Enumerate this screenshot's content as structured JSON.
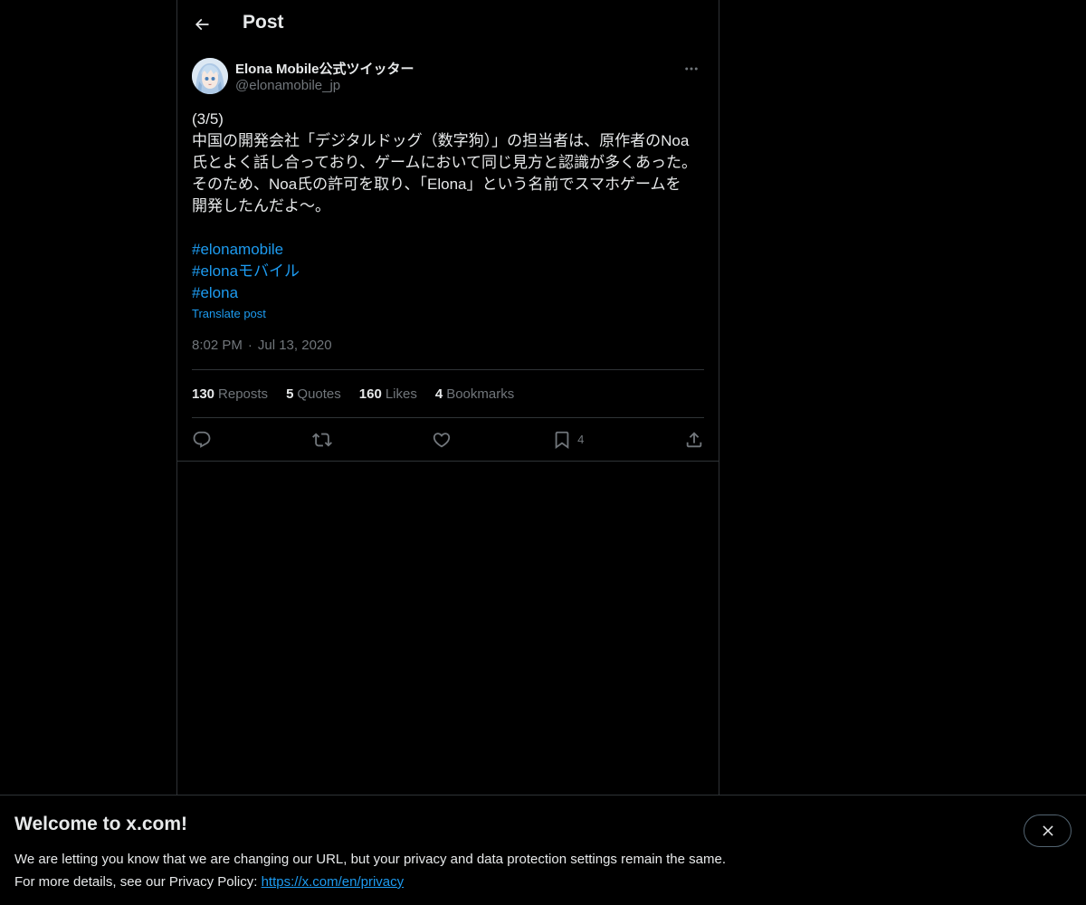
{
  "header": {
    "title": "Post"
  },
  "post": {
    "author": {
      "display_name": "Elona Mobile公式ツイッター",
      "handle": "@elonamobile_jp"
    },
    "text_lines": [
      "(3/5)",
      "中国の開発会社「デジタルドッグ（数字狗）」の担当者は、原作者のNoa",
      "氏とよく話し合っており、ゲームにおいて同じ見方と認識が多くあった。",
      "そのため、Noa氏の許可を取り、「Elona」という名前でスマホゲームを",
      "開発したんだよ〜。"
    ],
    "hashtags": [
      "#elonamobile",
      "#elonaモバイル",
      "#elona"
    ],
    "translate_label": "Translate post",
    "time": "8:02 PM",
    "date": "Jul 13, 2020",
    "time_separator": "·"
  },
  "stats": {
    "reposts": {
      "count": "130",
      "label": "Reposts"
    },
    "quotes": {
      "count": "5",
      "label": "Quotes"
    },
    "likes": {
      "count": "160",
      "label": "Likes"
    },
    "bookmarks": {
      "count": "4",
      "label": "Bookmarks"
    }
  },
  "actions": {
    "bookmark_count": "4",
    "icons": [
      "reply-icon",
      "repost-icon",
      "like-icon",
      "bookmark-icon",
      "share-icon"
    ]
  },
  "banner": {
    "title": "Welcome to x.com!",
    "line1": "We are letting you know that we are changing our URL, but your privacy and data protection settings remain the same.",
    "line2_prefix": "For more details, see our Privacy Policy: ",
    "privacy_link": "https://x.com/en/privacy"
  },
  "colors": {
    "background": "#000000",
    "text": "#e7e9ea",
    "muted": "#71767b",
    "accent": "#1d9bf0",
    "border": "#2f3336"
  }
}
